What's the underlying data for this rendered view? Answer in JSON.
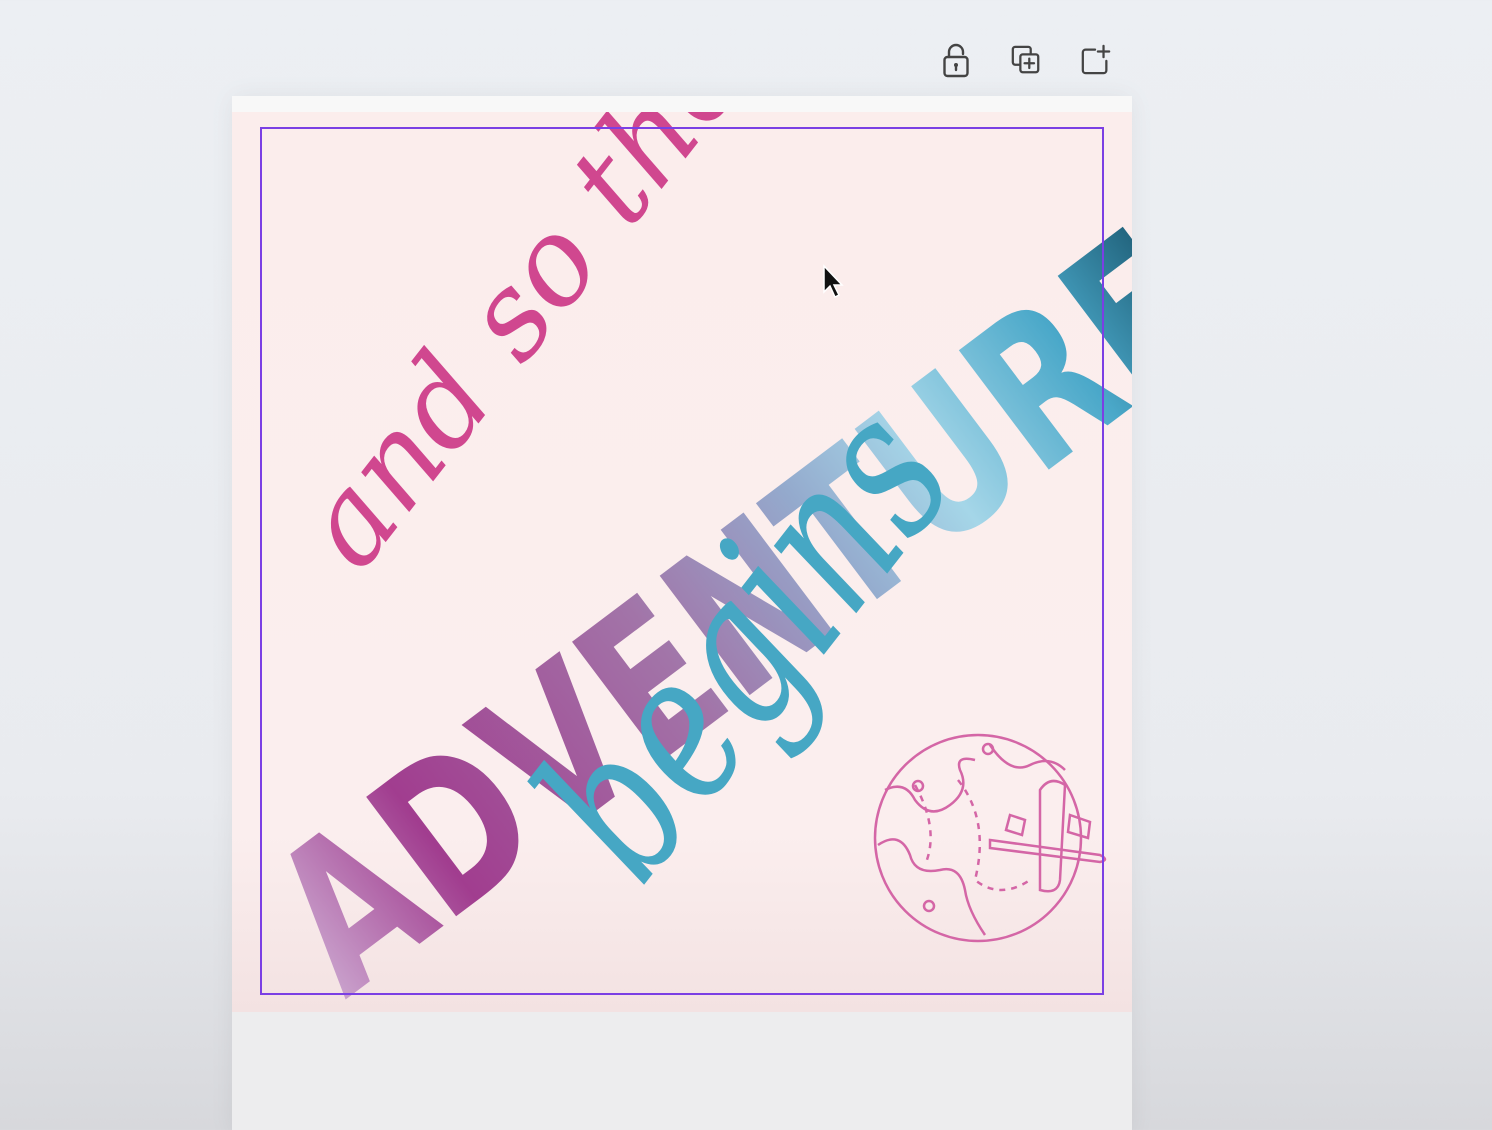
{
  "toolbar": {
    "lock": {
      "icon": "lock-open-icon"
    },
    "duplicate": {
      "icon": "duplicate-page-icon"
    },
    "add_page": {
      "icon": "add-page-icon"
    }
  },
  "design": {
    "line1": "and so the",
    "line2": "ADVENTURE",
    "line3": "begins",
    "globe_icon": "globe-airplane-icon",
    "colors": {
      "pink": "#d0478f",
      "purple": "#a03c8e",
      "lavender": "#9aa4cc",
      "teal": "#46a7c4",
      "background": "#fbedec",
      "selection": "#7b3fe4"
    }
  }
}
